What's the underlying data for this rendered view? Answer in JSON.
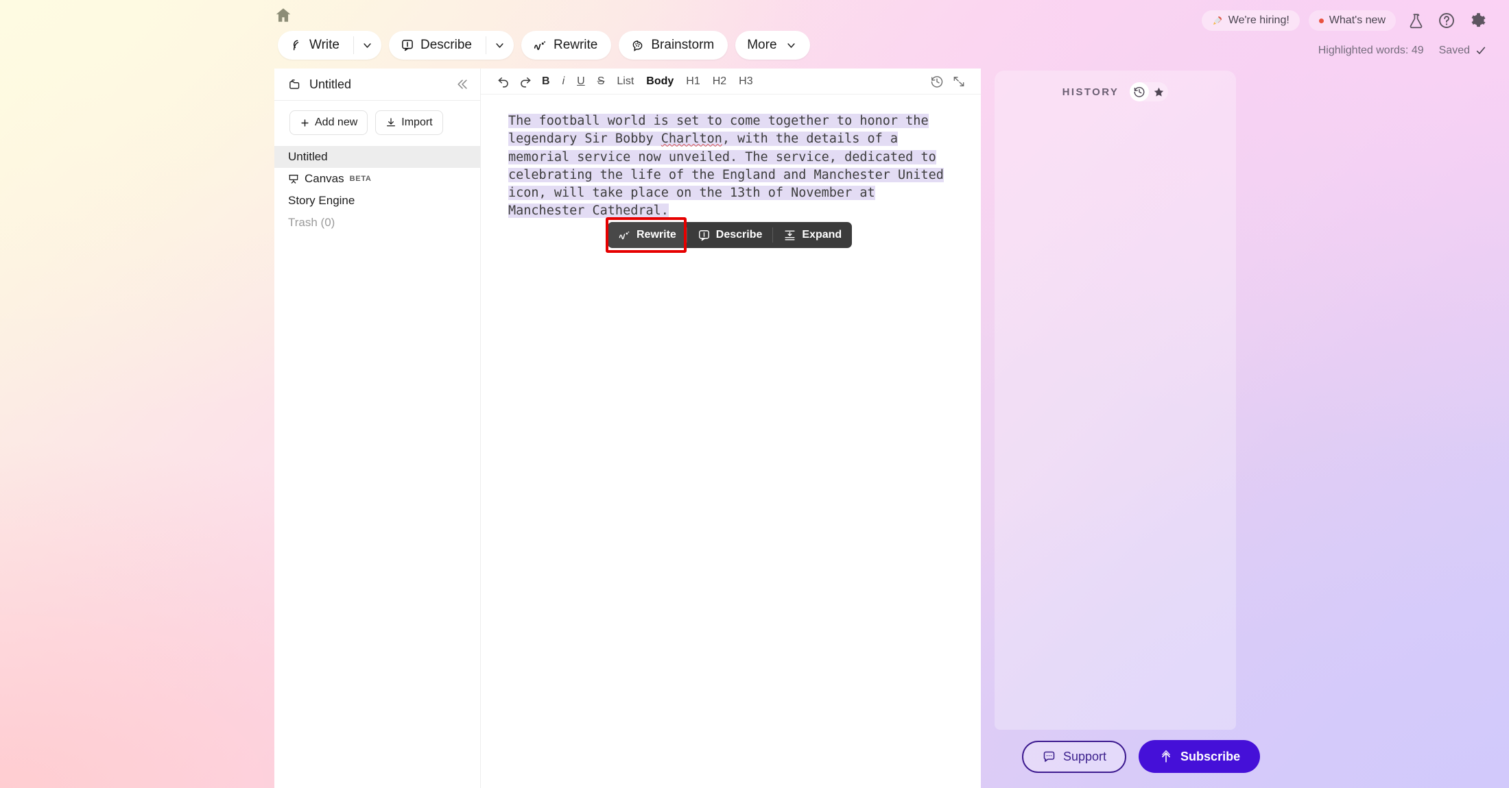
{
  "topbar": {
    "home_icon": "home-icon",
    "actions": [
      {
        "label": "Write",
        "icon": "feather-icon",
        "has_caret": true
      },
      {
        "label": "Describe",
        "icon": "describe-icon",
        "has_caret": true
      },
      {
        "label": "Rewrite",
        "icon": "rewrite-icon",
        "has_caret": false
      },
      {
        "label": "Brainstorm",
        "icon": "brain-icon",
        "has_caret": false
      },
      {
        "label": "More",
        "icon": "",
        "has_caret": true
      }
    ],
    "hiring_label": "We're hiring!",
    "hiring_icon": "rocket-icon",
    "whats_new_label": "What's new",
    "icons": [
      "flask-icon",
      "help-icon",
      "gear-icon"
    ],
    "highlighted_words": "Highlighted words: 49",
    "saved_label": "Saved"
  },
  "sidebar": {
    "title": "Untitled",
    "folder_icon": "folder-icon",
    "collapse_icon": "chevrons-left-icon",
    "add_new_label": "Add new",
    "import_label": "Import",
    "items": [
      {
        "label": "Untitled",
        "icon": "",
        "badge": "",
        "state": "active"
      },
      {
        "label": "Canvas",
        "icon": "canvas-icon",
        "badge": "BETA",
        "state": "normal"
      },
      {
        "label": "Story Engine",
        "icon": "",
        "badge": "",
        "state": "normal"
      },
      {
        "label": "Trash (0)",
        "icon": "",
        "badge": "",
        "state": "muted"
      }
    ]
  },
  "editor": {
    "toolbar": {
      "undo": "↶",
      "redo": "↷",
      "bold": "B",
      "italic": "i",
      "underline": "U",
      "strike": "S",
      "list": "List",
      "body": "Body",
      "h1": "H1",
      "h2": "H2",
      "h3": "H3",
      "history_icon": "clock-history-icon",
      "expand_icon": "expand-diagonal-icon"
    },
    "document": {
      "text_part1": "The football world is set to come together to honor the legendary Sir Bobby ",
      "misspelled_word": "Charlton",
      "text_part2": ", with the details of a memorial service now unveiled. The service, dedicated to celebrating the life of the England and Manchester United icon, will take place on the 13th of November at Manchester Cathedral.",
      "highlight_color": "#e3dcf4"
    },
    "float_toolbar": {
      "buttons": [
        {
          "label": "Rewrite",
          "icon": "rewrite-icon",
          "selected": true
        },
        {
          "label": "Describe",
          "icon": "describe-icon",
          "selected": false
        },
        {
          "label": "Expand",
          "icon": "expand-lines-icon",
          "selected": false
        }
      ],
      "annotation_color": "#e60000"
    }
  },
  "history_panel": {
    "title": "HISTORY",
    "toggle": {
      "left_icon": "clock-history-icon",
      "right_icon": "star-icon",
      "active": "left"
    }
  },
  "bottom": {
    "support_label": "Support",
    "support_icon": "chat-icon",
    "subscribe_label": "Subscribe",
    "subscribe_icon": "arrow-up-icon",
    "subscribe_color": "#4510d8"
  }
}
